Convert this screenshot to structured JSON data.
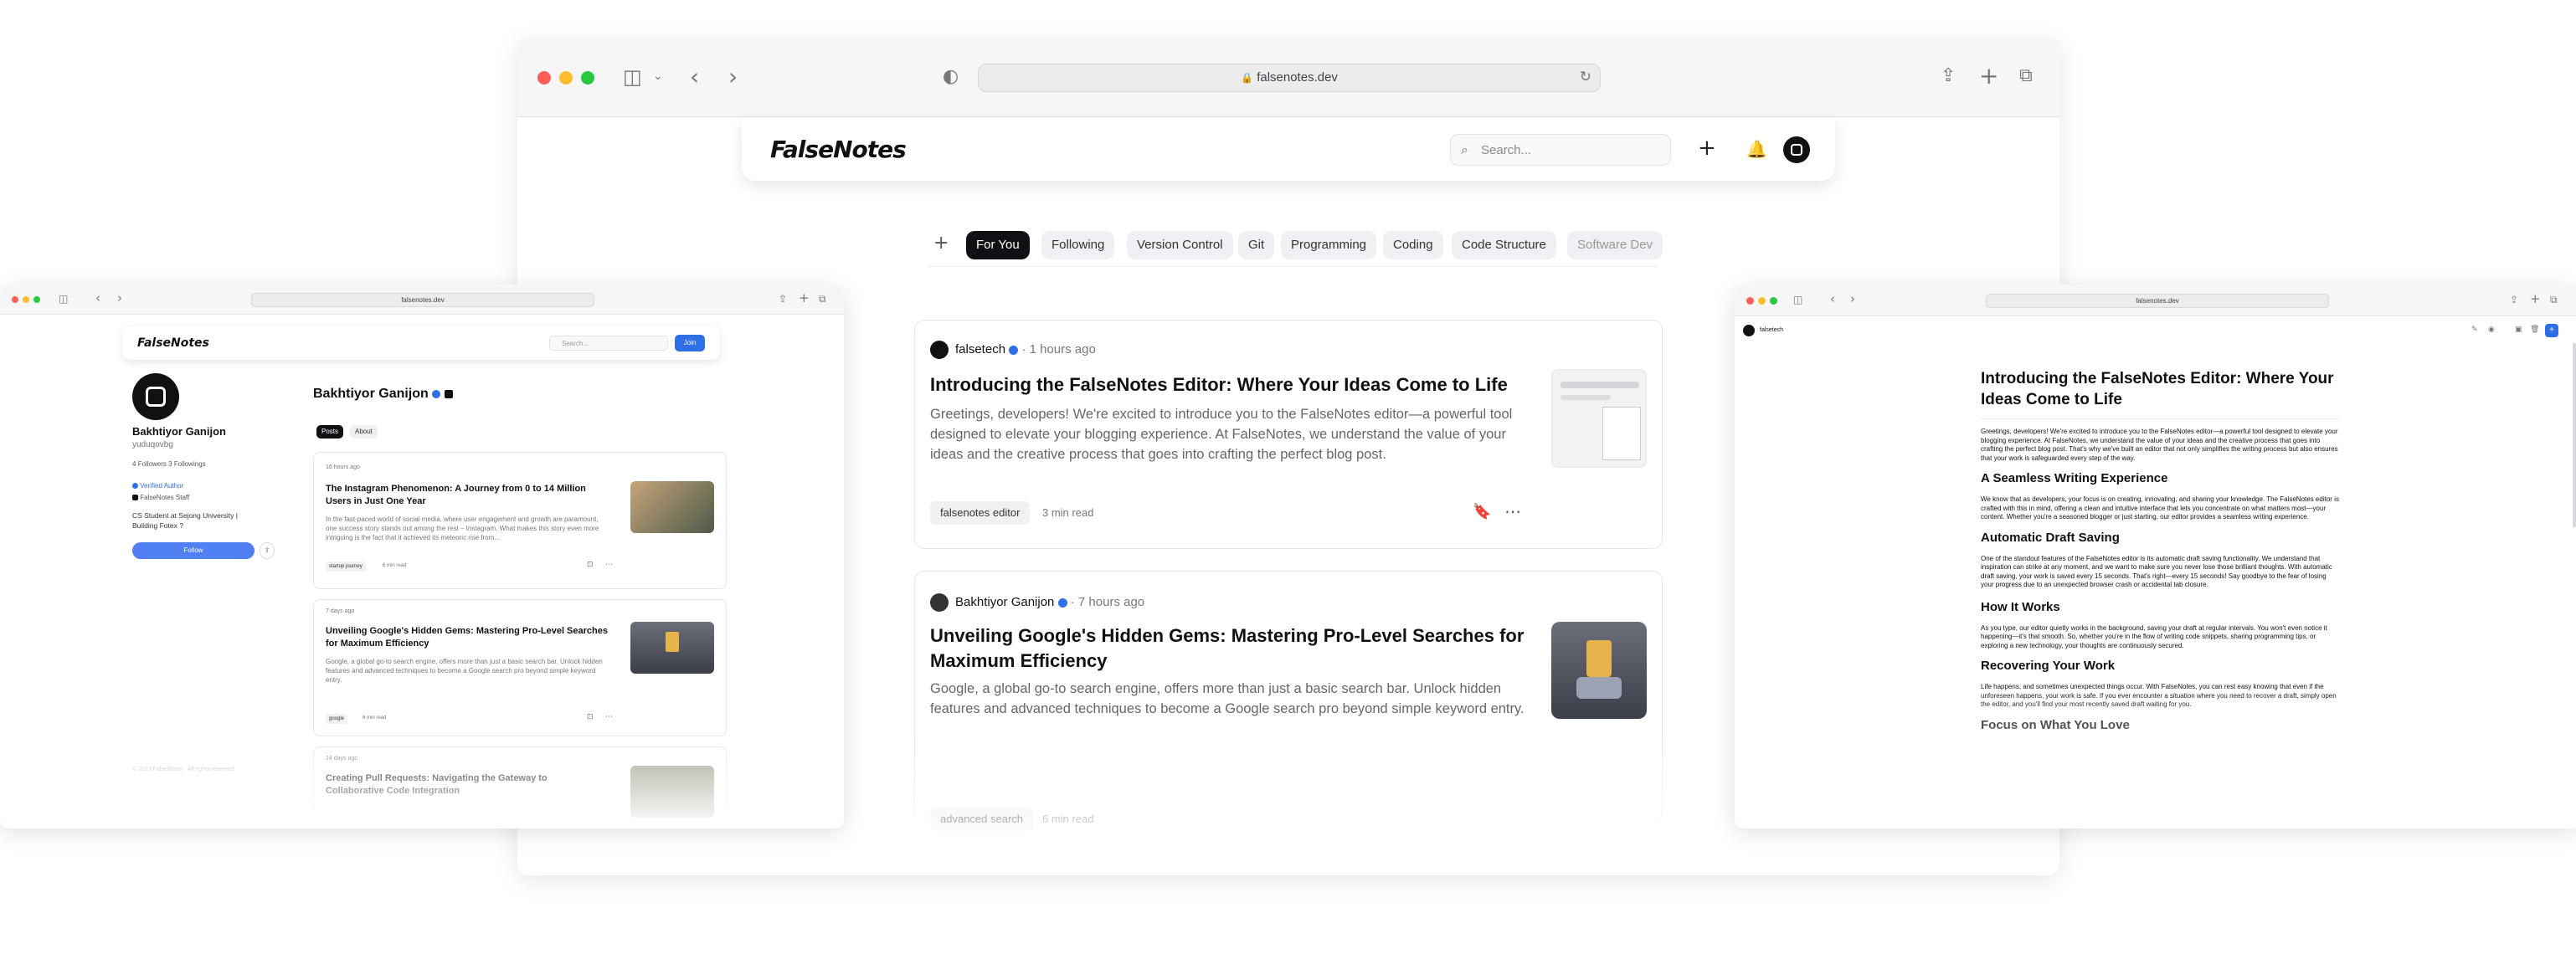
{
  "browser": {
    "url": "falsenotes.dev"
  },
  "brand": {
    "logo": "FalseNotes",
    "accent": "#2f6fe4"
  },
  "search": {
    "placeholder": "Search..."
  },
  "feed": {
    "tabs": [
      "For You",
      "Following",
      "Version Control",
      "Git",
      "Programming",
      "Coding",
      "Code Structure",
      "Software Dev"
    ],
    "posts": [
      {
        "author": "falsetech",
        "time": "1 hours ago",
        "title": "Introducing the FalseNotes Editor: Where Your Ideas Come to Life",
        "excerpt": "Greetings, developers! We're excited to introduce you to the FalseNotes editor—a powerful tool designed to elevate your blogging experience. At FalseNotes, we understand the value of your ideas and the creative process that goes into crafting the perfect blog post.",
        "tag": "falsenotes editor",
        "read": "3 min read"
      },
      {
        "author": "Bakhtiyor Ganijon",
        "time": "7 hours ago",
        "title": "Unveiling Google's Hidden Gems: Mastering Pro-Level Searches for Maximum Efficiency",
        "excerpt": "Google, a global go-to search engine, offers more than just a basic search bar. Unlock hidden features and advanced techniques to become a Google search pro beyond simple keyword entry.",
        "tag": "advanced search",
        "read": "6 min read"
      }
    ]
  },
  "profile": {
    "name": "Bakhtiyor Ganijon",
    "username": "yuduqovbg",
    "followers": "4",
    "followers_label": "Followers",
    "following": "3",
    "following_label": "Followings",
    "badge1": "Verified Author",
    "badge2": "FalseNotes Staff",
    "bio": "CS Student at Sejong University | Building Fotex ?",
    "follow": "Follow",
    "join": "Join",
    "tabs": [
      "Posts",
      "About"
    ],
    "posts": [
      {
        "time": "16 hours ago",
        "title": "The Instagram Phenomenon: A Journey from 0 to 14 Million Users in Just One Year",
        "excerpt": "In the fast-paced world of social media, where user engagement and growth are paramount, one success story stands out among the rest – Instagram. What makes this story even more intriguing is the fact that it achieved its meteoric rise from...",
        "tag": "startup journey",
        "read": "6 min read"
      },
      {
        "time": "7 days ago",
        "title": "Unveiling Google's Hidden Gems: Mastering Pro-Level Searches for Maximum Efficiency",
        "excerpt": "Google, a global go-to search engine, offers more than just a basic search bar. Unlock hidden features and advanced techniques to become a Google search pro beyond simple keyword entry.",
        "tag": "google",
        "read": "6 min read"
      },
      {
        "time": "14 days ago",
        "title": "Creating Pull Requests: Navigating the Gateway to Collaborative Code Integration",
        "excerpt": "",
        "tag": "",
        "read": ""
      }
    ],
    "footer": "© 2023 FalseNotes · All rights reserved"
  },
  "editor": {
    "user": "falsetech",
    "title": "Introducing the FalseNotes Editor: Where Your Ideas Come to Life",
    "p1": "Greetings, developers! We're excited to introduce you to the FalseNotes editor—a powerful tool designed to elevate your blogging experience. At FalseNotes, we understand the value of your ideas and the creative process that goes into crafting the perfect blog post. That's why we've built an editor that not only simplifies the writing process but also ensures that your work is safeguarded every step of the way.",
    "h1": "A Seamless Writing Experience",
    "p2": "We know that as developers, your focus is on creating, innovating, and sharing your knowledge. The FalseNotes editor is crafted with this in mind, offering a clean and intuitive interface that lets you concentrate on what matters most—your content. Whether you're a seasoned blogger or just starting, our editor provides a seamless writing experience.",
    "h2": "Automatic Draft Saving",
    "p3": "One of the standout features of the FalseNotes editor is its automatic draft saving functionality. We understand that inspiration can strike at any moment, and we want to make sure you never lose those brilliant thoughts. With automatic draft saving, your work is saved every 15 seconds. That's right—every 15 seconds! Say goodbye to the fear of losing your progress due to an unexpected browser crash or accidental tab closure.",
    "h3": "How It Works",
    "p4": "As you type, our editor quietly works in the background, saving your draft at regular intervals. You won't even notice it happening—it's that smooth. So, whether you're in the flow of writing code snippets, sharing programming tips, or exploring a new technology, your thoughts are continuously secured.",
    "h4": "Recovering Your Work",
    "p5": "Life happens, and sometimes unexpected things occur. With FalseNotes, you can rest easy knowing that even if the unforeseen happens, your work is safe. If you ever encounter a situation where you need to recover a draft, simply open the editor, and you'll find your most recently saved draft waiting for you.",
    "h5": "Focus on What You Love"
  }
}
